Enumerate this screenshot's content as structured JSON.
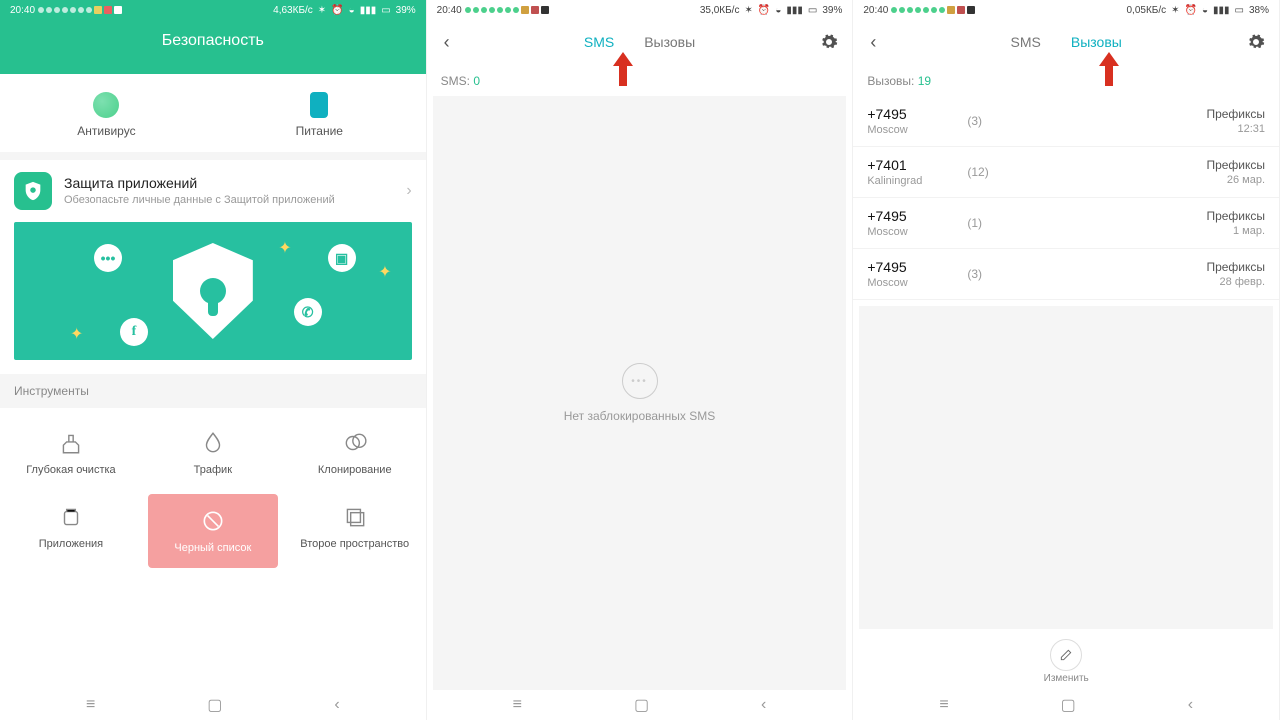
{
  "s1": {
    "status": {
      "time": "20:40",
      "net": "4,63КБ/с",
      "batt": "39%"
    },
    "title": "Безопасность",
    "quick": [
      {
        "label": "Антивирус",
        "color": "#4cd08c"
      },
      {
        "label": "Питание",
        "color": "#0fb0c0"
      }
    ],
    "applock": {
      "title": "Защита приложений",
      "sub": "Обезопасьте личные данные с Защитой приложений"
    },
    "tools_header": "Инструменты",
    "tools": [
      {
        "label": "Глубокая очистка"
      },
      {
        "label": "Трафик"
      },
      {
        "label": "Клонирование"
      },
      {
        "label": "Приложения"
      },
      {
        "label": "Черный список"
      },
      {
        "label": "Второе пространство"
      }
    ]
  },
  "s2": {
    "status": {
      "time": "20:40",
      "net": "35,0КБ/с",
      "batt": "39%"
    },
    "tabs": {
      "sms": "SMS",
      "calls": "Вызовы"
    },
    "count_label": "SMS:",
    "count_value": "0",
    "empty": "Нет заблокированных SMS"
  },
  "s3": {
    "status": {
      "time": "20:40",
      "net": "0,05КБ/с",
      "batt": "38%"
    },
    "tabs": {
      "sms": "SMS",
      "calls": "Вызовы"
    },
    "count_label": "Вызовы:",
    "count_value": "19",
    "rows": [
      {
        "num": "+7495",
        "loc": "Moscow",
        "cnt": "(3)",
        "tag": "Префиксы",
        "date": "12:31"
      },
      {
        "num": "+7401",
        "loc": "Kaliningrad",
        "cnt": "(12)",
        "tag": "Префиксы",
        "date": "26 мар."
      },
      {
        "num": "+7495",
        "loc": "Moscow",
        "cnt": "(1)",
        "tag": "Префиксы",
        "date": "1 мар."
      },
      {
        "num": "+7495",
        "loc": "Moscow",
        "cnt": "(3)",
        "tag": "Префиксы",
        "date": "28 февр."
      }
    ],
    "edit": "Изменить"
  }
}
